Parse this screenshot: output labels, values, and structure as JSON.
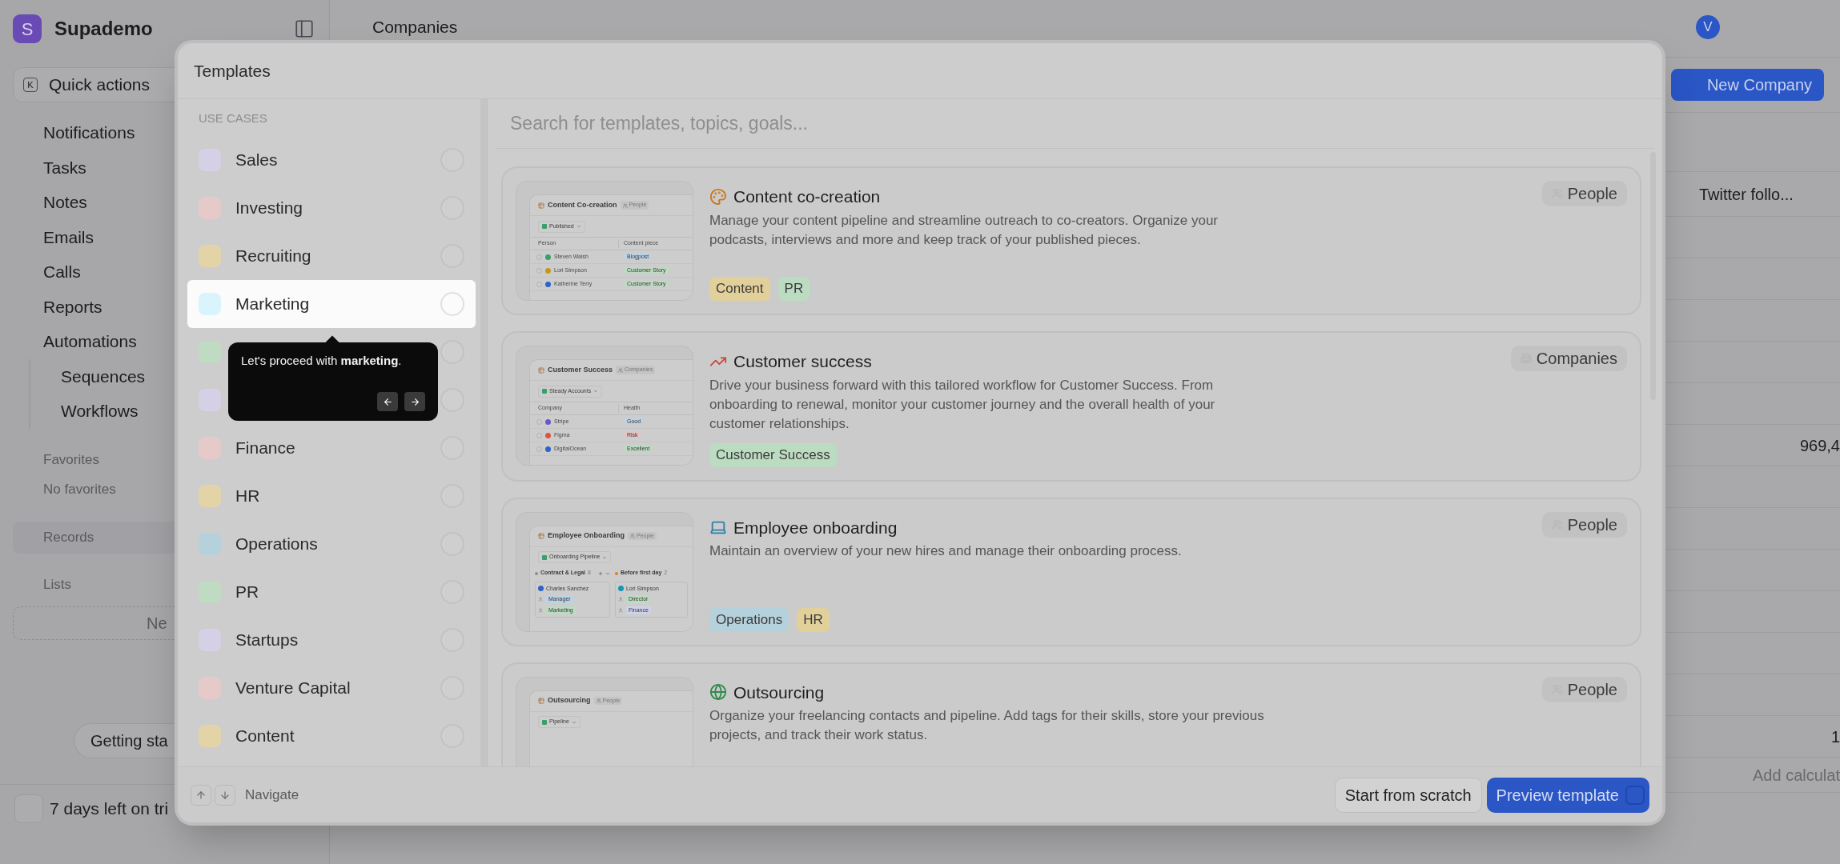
{
  "sidebar": {
    "logo_letter": "S",
    "workspace": "Supademo",
    "quick_actions": {
      "shortcut": "K",
      "label": "Quick actions"
    },
    "items": [
      {
        "label": "Notifications"
      },
      {
        "label": "Tasks"
      },
      {
        "label": "Notes"
      },
      {
        "label": "Emails"
      },
      {
        "label": "Calls"
      },
      {
        "label": "Reports"
      },
      {
        "label": "Automations",
        "children": [
          {
            "label": "Sequences"
          },
          {
            "label": "Workflows"
          }
        ]
      }
    ],
    "favorites": {
      "heading": "Favorites",
      "empty": "No favorites"
    },
    "records": {
      "heading": "Records"
    },
    "lists": {
      "heading": "Lists",
      "new_button": "Ne"
    },
    "getting_started": "Getting sta",
    "trial": "7 days left on tri"
  },
  "main": {
    "title": "Companies",
    "avatar": "V",
    "new_button": "New Company",
    "column_header": "Twitter follo...",
    "rows": [
      {},
      {},
      {},
      {},
      {},
      {
        "value": "969,4"
      },
      {},
      {},
      {},
      {},
      {},
      {},
      {
        "value": "1"
      }
    ],
    "footer": "Add calculat"
  },
  "modal": {
    "title": "Templates",
    "section": "USE CASES",
    "use_cases": [
      {
        "label": "Sales",
        "color": "#d6d0e6",
        "selected": false,
        "checked": false
      },
      {
        "label": "Investing",
        "color": "#e6c9c9",
        "selected": false,
        "checked": false
      },
      {
        "label": "Recruiting",
        "color": "#e2d4a6",
        "selected": false,
        "checked": false
      },
      {
        "label": "Marketing",
        "color": "#d9f4fc",
        "selected": true,
        "checked": false
      },
      {
        "color": "#bfdcc3",
        "selected": false,
        "checked": false
      },
      {
        "color": "#d6d0e6",
        "selected": false,
        "checked": false
      },
      {
        "label": "Finance",
        "color": "#e6c9c9",
        "selected": false,
        "checked": false
      },
      {
        "label": "HR",
        "color": "#e2d4a6",
        "selected": false,
        "checked": false
      },
      {
        "label": "Operations",
        "color": "#b5d1dc",
        "selected": false,
        "checked": false
      },
      {
        "label": "PR",
        "color": "#bfdcc3",
        "selected": false,
        "checked": false
      },
      {
        "label": "Startups",
        "color": "#d6d0e6",
        "selected": false,
        "checked": false
      },
      {
        "label": "Venture Capital",
        "color": "#e6c9c9",
        "selected": false,
        "checked": false
      },
      {
        "label": "Content",
        "color": "#e2d4a6",
        "selected": false,
        "checked": false
      }
    ],
    "tooltip": {
      "text": "Let's proceed with **marketing**."
    },
    "search": {
      "placeholder": "Search for templates, topics, goals..."
    },
    "templates": [
      {
        "title": "Content co-creation",
        "description": "Manage your content pipeline and streamline outreach to co-creators. Organize your podcasts, interviews and more and keep track of your published pieces.",
        "scope": "People",
        "tags": [
          {
            "label": "Content",
            "color": "#e2d09a"
          },
          {
            "label": "PR",
            "color": "#bcdcc1"
          }
        ],
        "preview": {
          "kind": "table",
          "title": "Content Co-creation",
          "scope": "People",
          "view": "Published",
          "columns": [
            "Person",
            "Content piece"
          ],
          "rows": [
            {
              "name": "Steven Walsh",
              "checked": false,
              "avatar": {
                "color": "#3a9f6a"
              },
              "tag": {
                "label": "Blogpost",
                "color": "#bcd3e6"
              }
            },
            {
              "name": "Lori Simpson",
              "checked": false,
              "avatar": {
                "color": "#c9961c"
              },
              "tag": {
                "label": "Customer Story",
                "color": "#bcdcc1"
              }
            },
            {
              "name": "Katherine Terry",
              "checked": false,
              "avatar": {
                "color": "#2f63c6"
              },
              "tag": {
                "label": "Customer Story",
                "color": "#bcdcc1"
              }
            }
          ]
        }
      },
      {
        "title": "Customer success",
        "description": "Drive your business forward with this tailored workflow for Customer Success. From onboarding to renewal, monitor your customer journey and the overall health of your customer relationships.",
        "scope": "Companies",
        "tags": [
          {
            "label": "Customer Success",
            "color": "#bcdcc1"
          }
        ],
        "preview": {
          "kind": "table",
          "title": "Customer Success",
          "scope": "Companies",
          "view": "Steady Accounts",
          "columns": [
            "Company",
            "Health"
          ],
          "rows": [
            {
              "name": "Stripe",
              "checked": false,
              "avatar": {
                "color": "#6a58c9"
              },
              "tag": {
                "label": "Good",
                "color": "#bcd3e6"
              }
            },
            {
              "name": "Figma",
              "checked": false,
              "avatar": {
                "color": "#d9583a"
              },
              "tag": {
                "label": "Risk",
                "color": "#e6c3c3"
              }
            },
            {
              "name": "DigitalOcean",
              "checked": false,
              "avatar": {
                "color": "#2f63c6"
              },
              "tag": {
                "label": "Excellent",
                "color": "#bcdcc1"
              }
            }
          ]
        }
      },
      {
        "title": "Employee onboarding",
        "description": "Maintain an overview of your new hires and manage their onboarding process.",
        "scope": "People",
        "tags": [
          {
            "label": "Operations",
            "color": "#b5d1dc"
          },
          {
            "label": "HR",
            "color": "#e2d09a"
          }
        ],
        "preview": {
          "kind": "board",
          "title": "Employee Onboarding",
          "scope": "People",
          "view": "Onboarding Pipeline",
          "groups": [
            {
              "label": "Contract & Legal",
              "count": "8",
              "color": "#8e8e8e",
              "card": {
                "name": "Charles Sanchez",
                "color": "#2f63c6",
                "tags": [
                  {
                    "label": "Manager",
                    "color": "#bcd3e6"
                  },
                  {
                    "label": "Marketing",
                    "color": "#bcdcc1"
                  }
                ]
              }
            },
            {
              "label": "Before first day",
              "count": "2",
              "color": "#d9802c",
              "card": {
                "name": "Lori Simpson",
                "color": "#1a96b4",
                "tags": [
                  {
                    "label": "Director",
                    "color": "#bcdcc1"
                  },
                  {
                    "label": "Finance",
                    "color": "#cdd1ea"
                  }
                ]
              }
            }
          ]
        }
      },
      {
        "title": "Outsourcing",
        "description": "Organize your freelancing contacts and pipeline. Add tags for their skills, store your previous projects, and track their work status.",
        "scope": "People",
        "preview": {
          "kind": "board",
          "title": "Outsourcing",
          "scope": "People",
          "view": "Pipeline"
        }
      }
    ],
    "footer": {
      "navigate": "Navigate",
      "secondary_button": "Start from scratch",
      "primary_button": "Preview template"
    }
  }
}
